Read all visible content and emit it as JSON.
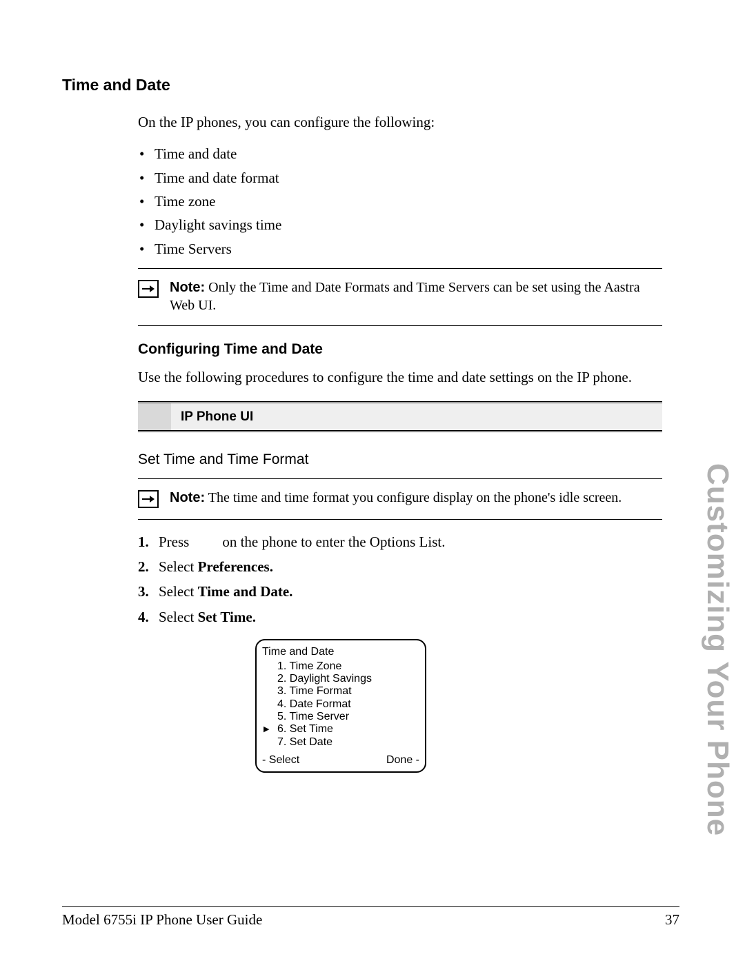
{
  "side_title": "Customizing Your Phone",
  "heading": "Time and Date",
  "intro": "On the IP phones, you can configure the following:",
  "bullets": [
    "Time and date",
    "Time and date format",
    "Time zone",
    "Daylight savings time",
    "Time Servers"
  ],
  "note1": {
    "label": "Note:",
    "text": " Only the Time and Date Formats and Time Servers can be set using the Aastra Web UI."
  },
  "sub_heading": "Configuring Time and Date",
  "sub_intro": "Use the following procedures to configure the time and date settings on the IP phone.",
  "ui_bar": "IP Phone UI",
  "h4": "Set Time and Time Format",
  "note2": {
    "label": "Note:",
    "text": " The time and time format you configure display on the phone's idle screen."
  },
  "steps": {
    "s1a": "Press",
    "s1b": "on the phone to enter the Options List.",
    "s2_prefix": "Select ",
    "s2_bold": "Preferences.",
    "s3_prefix": "Select ",
    "s3_bold": "Time and Date.",
    "s4_prefix": "Select ",
    "s4_bold": "Set Time."
  },
  "phone": {
    "title": "Time and Date",
    "items": [
      "1. Time Zone",
      "2. Daylight Savings",
      "3. Time Format",
      "4. Date Format",
      "5. Time Server",
      "6. Set Time",
      "7. Set Date"
    ],
    "selected_index": 5,
    "left_soft": "- Select",
    "right_soft": "Done -"
  },
  "footer": {
    "left": "Model 6755i IP Phone User Guide",
    "right": "37"
  }
}
